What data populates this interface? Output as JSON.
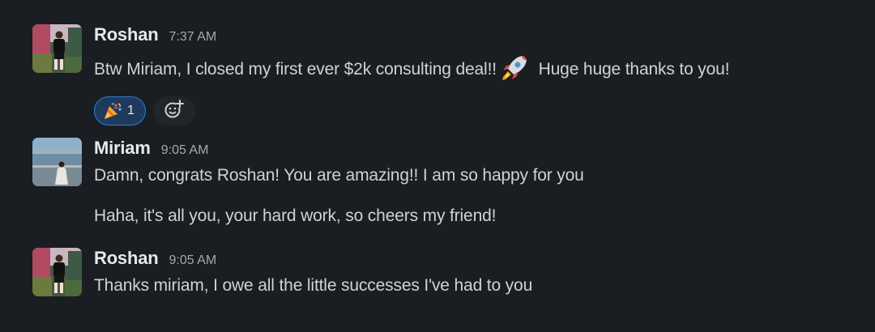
{
  "messages": [
    {
      "sender": "Roshan",
      "time": "7:37 AM",
      "text_before": "Btw Miriam, I closed my first ever $2k consulting deal!!",
      "emoji": "rocket",
      "text_after": "Huge huge thanks to you!",
      "reaction": {
        "emoji": "party-popper",
        "count": "1"
      }
    },
    {
      "sender": "Miriam",
      "time": "9:05 AM",
      "lines": [
        "Damn, congrats Roshan! You are amazing!! I am so happy for you",
        "Haha, it's all you, your hard work, so cheers my friend!"
      ]
    },
    {
      "sender": "Roshan",
      "time": "9:05 AM",
      "text": "Thanks miriam, I owe all the little successes I've had to you"
    }
  ],
  "icons": {
    "add_reaction": "add-emoji-icon",
    "reaction": "party-popper-icon",
    "inline_emoji": "rocket-icon"
  },
  "colors": {
    "background": "#1a1d21",
    "reaction_border": "#2d7fd0",
    "reaction_fill": "#1f3a5c"
  }
}
